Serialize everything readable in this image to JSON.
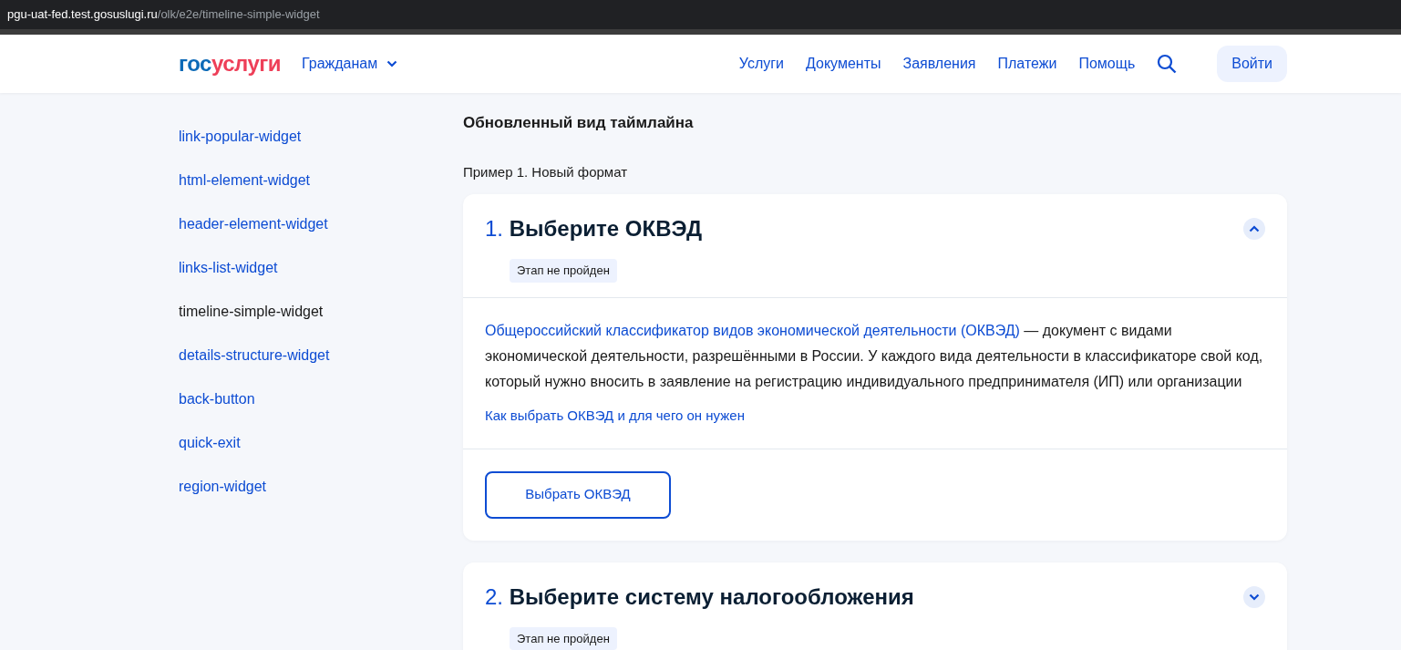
{
  "address_bar": {
    "host": "pgu-uat-fed.test.gosuslugi.ru",
    "path": "/olk/e2e/timeline-simple-widget"
  },
  "header": {
    "logo_first": "гос",
    "logo_second": "услуги",
    "audience": "Гражданам",
    "nav": [
      "Услуги",
      "Документы",
      "Заявления",
      "Платежи",
      "Помощь"
    ],
    "login": "Войти"
  },
  "sidebar": {
    "items": [
      {
        "label": "link-popular-widget",
        "selected": false
      },
      {
        "label": "html-element-widget",
        "selected": false
      },
      {
        "label": "header-element-widget",
        "selected": false
      },
      {
        "label": "links-list-widget",
        "selected": false
      },
      {
        "label": "timeline-simple-widget",
        "selected": true
      },
      {
        "label": "details-structure-widget",
        "selected": false
      },
      {
        "label": "back-button",
        "selected": false
      },
      {
        "label": "quick-exit",
        "selected": false
      },
      {
        "label": "region-widget",
        "selected": false
      }
    ]
  },
  "content": {
    "title": "Обновленный вид таймлайна",
    "example": "Пример 1. Новый формат",
    "steps": [
      {
        "number": "1.",
        "title": "Выберите ОКВЭД",
        "status": "Этап не пройден",
        "expanded": true,
        "description_link": "Общероссийский классификатор видов экономической деятельности (ОКВЭД)",
        "description": " — документ с видами экономической деятельности, разрешёнными в России. У каждого вида деятельности в классификаторе свой код, который нужно вносить в заявление на регистрацию индивидуального предпринимателя (ИП) или организации",
        "link": "Как выбрать ОКВЭД и для чего он нужен",
        "button": "Выбрать ОКВЭД"
      },
      {
        "number": "2.",
        "title": "Выберите систему налогообложения",
        "status": "Этап не пройден",
        "expanded": false
      }
    ]
  }
}
